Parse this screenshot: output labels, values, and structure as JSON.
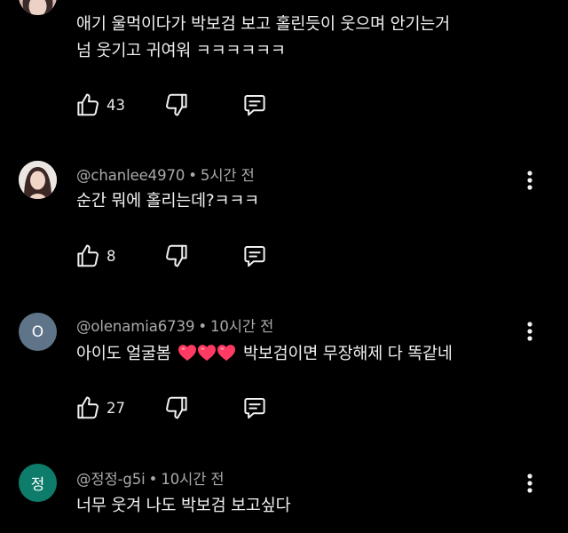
{
  "comments": [
    {
      "author": "",
      "time": "",
      "lines": [
        "애기 울먹이다가 박보검 보고 홀린듯이 웃으며 안기는거",
        "넘 웃기고 귀여워 ㅋㅋㅋㅋㅋㅋ"
      ],
      "likes": "43"
    },
    {
      "author": "@chanlee4970",
      "time": "5시간 전",
      "lines": [
        "순간 뭐에 홀리는데?ㅋㅋㅋ"
      ],
      "likes": "8"
    },
    {
      "author": "@olenamia6739",
      "time": "10시간 전",
      "avatar_letter": "O",
      "avatar_color": "#5f7488",
      "text_before": "아이도 얼굴봄",
      "text_after": "박보검이면 무장해제 다 똑같네",
      "likes": "27"
    },
    {
      "author": "@정정-g5i",
      "time": "10시간 전",
      "avatar_letter": "정",
      "avatar_color": "#0e7c6b",
      "lines": [
        "너무 웃겨 나도 박보검 보고싶다"
      ]
    }
  ],
  "separator": "•",
  "heart_color": "#ff3b63",
  "icons": {
    "like": "thumbs-up-icon",
    "dislike": "thumbs-down-icon",
    "reply": "reply-icon",
    "more": "more-vert-icon"
  }
}
